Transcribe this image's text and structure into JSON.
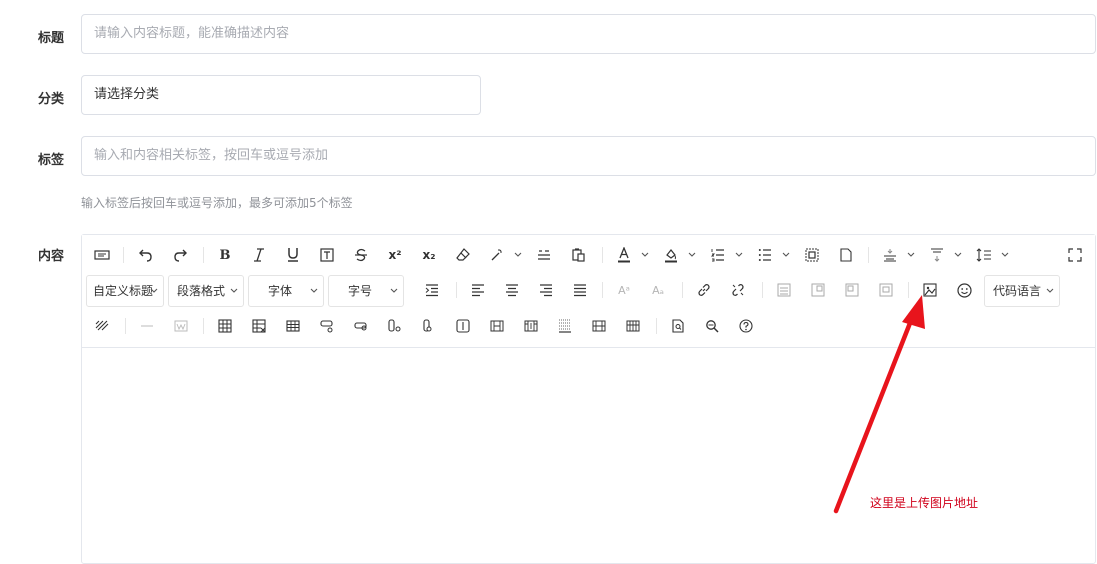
{
  "form": {
    "title": {
      "label": "标题",
      "placeholder": "请输入内容标题，能准确描述内容"
    },
    "category": {
      "label": "分类",
      "value": "请选择分类"
    },
    "tags": {
      "label": "标签",
      "placeholder": "输入和内容相关标签，按回车或逗号添加",
      "hint": "输入标签后按回车或逗号添加，最多可添加5个标签"
    },
    "content": {
      "label": "内容"
    }
  },
  "toolbar": {
    "custom_heading": "自定义标题",
    "paragraph_format": "段落格式",
    "font_family": "字体",
    "font_size": "字号",
    "code_language": "代码语言"
  },
  "annotation": {
    "text": "这里是上传图片地址",
    "color": "#e8141c"
  }
}
